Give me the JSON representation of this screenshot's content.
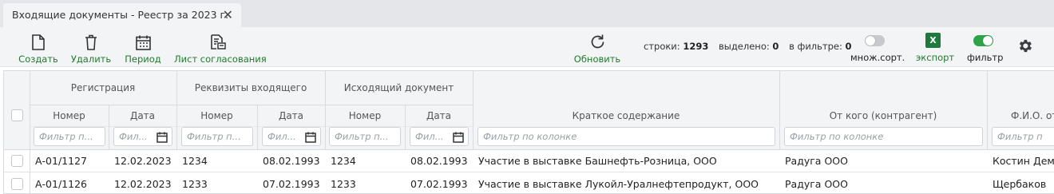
{
  "tab": {
    "title": "Входящие документы - Реестр за 2023 г.",
    "close": "✕"
  },
  "toolbar": {
    "create": "Создать",
    "delete": "Удалить",
    "period": "Период",
    "approval_sheet": "Лист согласования",
    "refresh": "Обновить",
    "multisort": "множ.сорт.",
    "export": "экспорт",
    "export_icon": "X",
    "filter": "фильтр",
    "multisort_on": false,
    "filter_on": true,
    "accent": "#1f7a2e"
  },
  "stats": {
    "rows_label": "строки:",
    "rows_value": "1293",
    "selected_label": "выделено:",
    "selected_value": "0",
    "filtered_label": "в фильтре:",
    "filtered_value": "0"
  },
  "grid": {
    "groups": {
      "registration": "Регистрация",
      "incoming_details": "Реквизиты входящего",
      "outgoing_doc": "Исходящий документ"
    },
    "columns": {
      "number": "Номер",
      "date": "Дата",
      "summary": "Краткое содержание",
      "from": "От кого (контрагент)",
      "fio": "Ф.И.О. от"
    },
    "filter_placeholder_short": "Фильтр п...",
    "filter_placeholder_date": "Фил...",
    "filter_placeholder_full": "Фильтр по колонке",
    "filter_placeholder_cut": "Фильтр п",
    "rows": [
      {
        "reg_no": "А-01/1127",
        "reg_date": "12.02.2023",
        "in_no": "1234",
        "in_date": "08.02.1993",
        "out_no": "1234",
        "out_date": "08.02.1993",
        "summary": "Участие в выставке Башнефть-Розница, ООО",
        "from": "Радуга ООО",
        "fio": "Костин Дем"
      },
      {
        "reg_no": "А-01/1126",
        "reg_date": "12.02.2023",
        "in_no": "1233",
        "in_date": "07.02.1993",
        "out_no": "1233",
        "out_date": "07.02.1993",
        "summary": "Участие в выставке Лукойл-Уралнефтепродукт, ООО",
        "from": "Радуга ООО",
        "fio": "Щербаков"
      }
    ]
  }
}
